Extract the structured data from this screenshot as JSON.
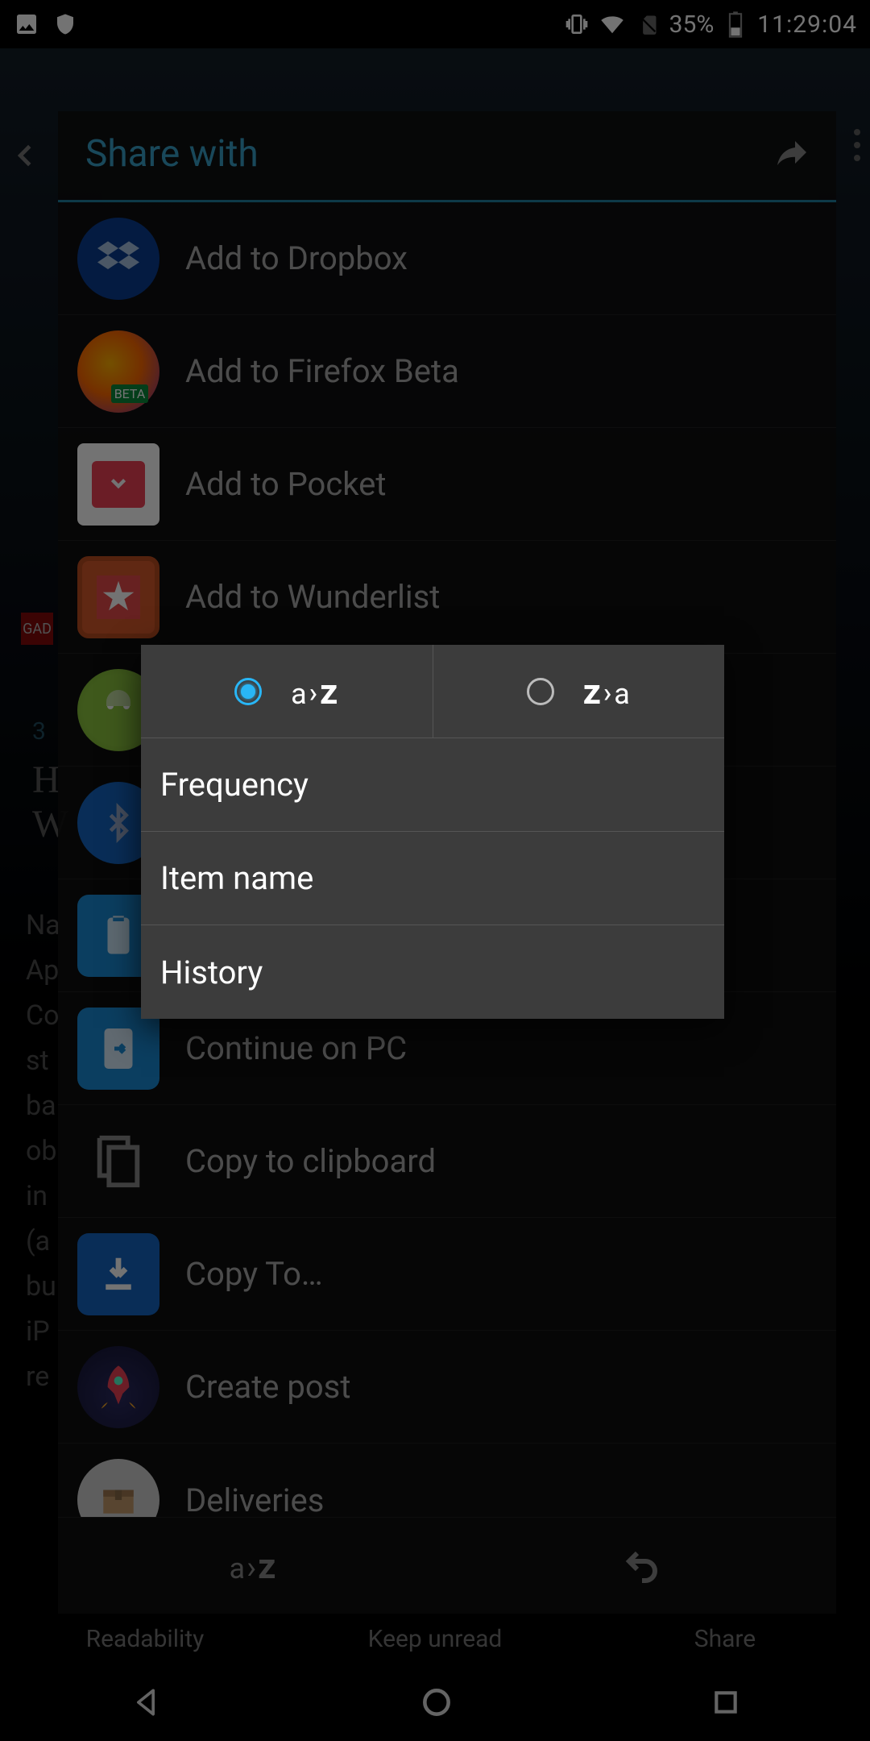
{
  "status_bar": {
    "battery_pct": "35%",
    "time": "11:29:04"
  },
  "reader": {
    "date_fragment": "3",
    "title_line1": "H",
    "title_line2": "W",
    "body_lines": [
      "Na",
      "Ap",
      "Co",
      "st",
      "ba",
      "ob",
      "in",
      "(a",
      "bu",
      "iP",
      "re"
    ],
    "badge": "GAD"
  },
  "share": {
    "title": "Share with",
    "items": [
      {
        "icon": "dropbox",
        "label": "Add to Dropbox"
      },
      {
        "icon": "firefox",
        "label": "Add to Firefox Beta"
      },
      {
        "icon": "pocket",
        "label": "Add to Pocket"
      },
      {
        "icon": "wunderlist",
        "label": "Add to Wunderlist"
      },
      {
        "icon": "android",
        "label": ""
      },
      {
        "icon": "bluetooth",
        "label": ""
      },
      {
        "icon": "clipboard",
        "label": ""
      },
      {
        "icon": "continue",
        "label": "Continue on PC"
      },
      {
        "icon": "copy",
        "label": "Copy to clipboard"
      },
      {
        "icon": "copyto",
        "label": "Copy To…"
      },
      {
        "icon": "rocket",
        "label": "Create post"
      },
      {
        "icon": "deliveries",
        "label": "Deliveries"
      }
    ],
    "bottom": {
      "sort": "a›z",
      "undo": "undo"
    }
  },
  "sort_popup": {
    "dir_asc": {
      "label_a": "a",
      "label_arrow": "›",
      "label_z": "z",
      "selected": true
    },
    "dir_desc": {
      "label_z": "z",
      "label_arrow": "›",
      "label_a": "a",
      "selected": false
    },
    "options": [
      "Frequency",
      "Item name",
      "History"
    ]
  },
  "article_actions": {
    "readability": "Readability",
    "keep_unread": "Keep unread",
    "share": "Share"
  }
}
